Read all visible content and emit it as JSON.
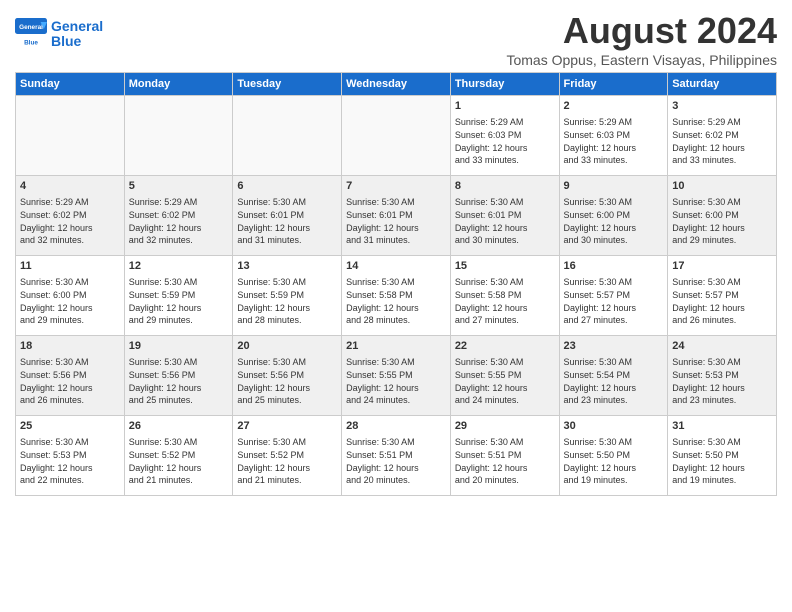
{
  "header": {
    "logo_line1": "General",
    "logo_line2": "Blue",
    "month_year": "August 2024",
    "location": "Tomas Oppus, Eastern Visayas, Philippines"
  },
  "days_of_week": [
    "Sunday",
    "Monday",
    "Tuesday",
    "Wednesday",
    "Thursday",
    "Friday",
    "Saturday"
  ],
  "weeks": [
    [
      {
        "day": "",
        "content": ""
      },
      {
        "day": "",
        "content": ""
      },
      {
        "day": "",
        "content": ""
      },
      {
        "day": "",
        "content": ""
      },
      {
        "day": "1",
        "content": "Sunrise: 5:29 AM\nSunset: 6:03 PM\nDaylight: 12 hours\nand 33 minutes."
      },
      {
        "day": "2",
        "content": "Sunrise: 5:29 AM\nSunset: 6:03 PM\nDaylight: 12 hours\nand 33 minutes."
      },
      {
        "day": "3",
        "content": "Sunrise: 5:29 AM\nSunset: 6:02 PM\nDaylight: 12 hours\nand 33 minutes."
      }
    ],
    [
      {
        "day": "4",
        "content": "Sunrise: 5:29 AM\nSunset: 6:02 PM\nDaylight: 12 hours\nand 32 minutes."
      },
      {
        "day": "5",
        "content": "Sunrise: 5:29 AM\nSunset: 6:02 PM\nDaylight: 12 hours\nand 32 minutes."
      },
      {
        "day": "6",
        "content": "Sunrise: 5:30 AM\nSunset: 6:01 PM\nDaylight: 12 hours\nand 31 minutes."
      },
      {
        "day": "7",
        "content": "Sunrise: 5:30 AM\nSunset: 6:01 PM\nDaylight: 12 hours\nand 31 minutes."
      },
      {
        "day": "8",
        "content": "Sunrise: 5:30 AM\nSunset: 6:01 PM\nDaylight: 12 hours\nand 30 minutes."
      },
      {
        "day": "9",
        "content": "Sunrise: 5:30 AM\nSunset: 6:00 PM\nDaylight: 12 hours\nand 30 minutes."
      },
      {
        "day": "10",
        "content": "Sunrise: 5:30 AM\nSunset: 6:00 PM\nDaylight: 12 hours\nand 29 minutes."
      }
    ],
    [
      {
        "day": "11",
        "content": "Sunrise: 5:30 AM\nSunset: 6:00 PM\nDaylight: 12 hours\nand 29 minutes."
      },
      {
        "day": "12",
        "content": "Sunrise: 5:30 AM\nSunset: 5:59 PM\nDaylight: 12 hours\nand 29 minutes."
      },
      {
        "day": "13",
        "content": "Sunrise: 5:30 AM\nSunset: 5:59 PM\nDaylight: 12 hours\nand 28 minutes."
      },
      {
        "day": "14",
        "content": "Sunrise: 5:30 AM\nSunset: 5:58 PM\nDaylight: 12 hours\nand 28 minutes."
      },
      {
        "day": "15",
        "content": "Sunrise: 5:30 AM\nSunset: 5:58 PM\nDaylight: 12 hours\nand 27 minutes."
      },
      {
        "day": "16",
        "content": "Sunrise: 5:30 AM\nSunset: 5:57 PM\nDaylight: 12 hours\nand 27 minutes."
      },
      {
        "day": "17",
        "content": "Sunrise: 5:30 AM\nSunset: 5:57 PM\nDaylight: 12 hours\nand 26 minutes."
      }
    ],
    [
      {
        "day": "18",
        "content": "Sunrise: 5:30 AM\nSunset: 5:56 PM\nDaylight: 12 hours\nand 26 minutes."
      },
      {
        "day": "19",
        "content": "Sunrise: 5:30 AM\nSunset: 5:56 PM\nDaylight: 12 hours\nand 25 minutes."
      },
      {
        "day": "20",
        "content": "Sunrise: 5:30 AM\nSunset: 5:56 PM\nDaylight: 12 hours\nand 25 minutes."
      },
      {
        "day": "21",
        "content": "Sunrise: 5:30 AM\nSunset: 5:55 PM\nDaylight: 12 hours\nand 24 minutes."
      },
      {
        "day": "22",
        "content": "Sunrise: 5:30 AM\nSunset: 5:55 PM\nDaylight: 12 hours\nand 24 minutes."
      },
      {
        "day": "23",
        "content": "Sunrise: 5:30 AM\nSunset: 5:54 PM\nDaylight: 12 hours\nand 23 minutes."
      },
      {
        "day": "24",
        "content": "Sunrise: 5:30 AM\nSunset: 5:53 PM\nDaylight: 12 hours\nand 23 minutes."
      }
    ],
    [
      {
        "day": "25",
        "content": "Sunrise: 5:30 AM\nSunset: 5:53 PM\nDaylight: 12 hours\nand 22 minutes."
      },
      {
        "day": "26",
        "content": "Sunrise: 5:30 AM\nSunset: 5:52 PM\nDaylight: 12 hours\nand 21 minutes."
      },
      {
        "day": "27",
        "content": "Sunrise: 5:30 AM\nSunset: 5:52 PM\nDaylight: 12 hours\nand 21 minutes."
      },
      {
        "day": "28",
        "content": "Sunrise: 5:30 AM\nSunset: 5:51 PM\nDaylight: 12 hours\nand 20 minutes."
      },
      {
        "day": "29",
        "content": "Sunrise: 5:30 AM\nSunset: 5:51 PM\nDaylight: 12 hours\nand 20 minutes."
      },
      {
        "day": "30",
        "content": "Sunrise: 5:30 AM\nSunset: 5:50 PM\nDaylight: 12 hours\nand 19 minutes."
      },
      {
        "day": "31",
        "content": "Sunrise: 5:30 AM\nSunset: 5:50 PM\nDaylight: 12 hours\nand 19 minutes."
      }
    ]
  ]
}
